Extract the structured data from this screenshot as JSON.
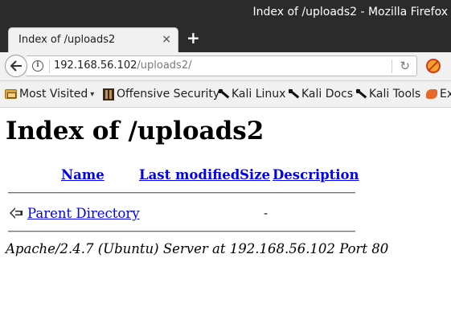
{
  "window": {
    "title": "Index of /uploads2 - Mozilla Firefox"
  },
  "tab": {
    "label": "Index of /uploads2",
    "close": "×",
    "new_tab": "+"
  },
  "navbar": {
    "url_host": "192.168.56.102",
    "url_path": "/uploads2/",
    "info_glyph": "i",
    "reload_glyph": "↻",
    "back_glyph": "←"
  },
  "bookmarks": {
    "most_visited": "Most Visited",
    "items": [
      "Offensive Security",
      "Kali Linux",
      "Kali Docs",
      "Kali Tools",
      "Ex"
    ],
    "icons": [
      "folder-icon",
      "offsec-icon",
      "kali-icon",
      "kali-icon",
      "kali-icon",
      "exploit-db-icon"
    ]
  },
  "page": {
    "heading": "Index of /uploads2",
    "columns": {
      "name": "Name",
      "last_modified": "Last modified",
      "size": "Size",
      "description": "Description"
    },
    "rows": [
      {
        "name": "Parent Directory",
        "last_modified": "",
        "size": "-",
        "description": ""
      }
    ],
    "address": "Apache/2.4.7 (Ubuntu) Server at 192.168.56.102 Port 80"
  },
  "colors": {
    "link": "#0000ee",
    "titlebar": "#2b2b2b",
    "chrome": "#f1f1f1"
  }
}
